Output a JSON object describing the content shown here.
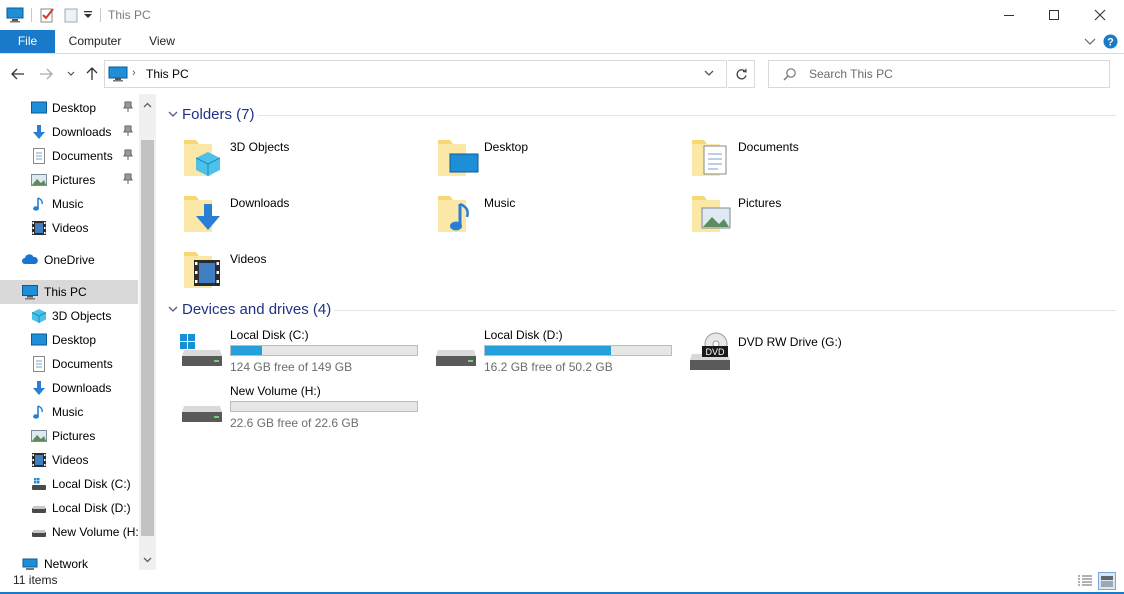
{
  "window": {
    "title": "This PC"
  },
  "ribbon": {
    "tabs": [
      "File",
      "Computer",
      "View"
    ]
  },
  "address": {
    "crumb": "This PC",
    "search_placeholder": "Search This PC"
  },
  "sidebar": {
    "quick_access": [
      {
        "label": "Desktop",
        "icon": "desktop-icon",
        "pinned": true
      },
      {
        "label": "Downloads",
        "icon": "downloads-icon",
        "pinned": true
      },
      {
        "label": "Documents",
        "icon": "documents-icon",
        "pinned": true
      },
      {
        "label": "Pictures",
        "icon": "pictures-icon",
        "pinned": true
      },
      {
        "label": "Music",
        "icon": "music-icon",
        "pinned": false
      },
      {
        "label": "Videos",
        "icon": "videos-icon",
        "pinned": false
      }
    ],
    "onedrive": "OneDrive",
    "this_pc": "This PC",
    "this_pc_children": [
      {
        "label": "3D Objects",
        "icon": "3d-objects-icon"
      },
      {
        "label": "Desktop",
        "icon": "desktop-icon"
      },
      {
        "label": "Documents",
        "icon": "documents-icon"
      },
      {
        "label": "Downloads",
        "icon": "downloads-icon"
      },
      {
        "label": "Music",
        "icon": "music-icon"
      },
      {
        "label": "Pictures",
        "icon": "pictures-icon"
      },
      {
        "label": "Videos",
        "icon": "videos-icon"
      },
      {
        "label": "Local Disk (C:)",
        "icon": "drive-icon"
      },
      {
        "label": "Local Disk (D:)",
        "icon": "drive-icon"
      },
      {
        "label": "New Volume (H:",
        "icon": "drive-icon"
      }
    ],
    "network": "Network"
  },
  "folders": {
    "header": "Folders (7)",
    "items": [
      {
        "label": "3D Objects",
        "icon": "3d-objects-folder-icon"
      },
      {
        "label": "Desktop",
        "icon": "desktop-folder-icon"
      },
      {
        "label": "Documents",
        "icon": "documents-folder-icon"
      },
      {
        "label": "Downloads",
        "icon": "downloads-folder-icon"
      },
      {
        "label": "Music",
        "icon": "music-folder-icon"
      },
      {
        "label": "Pictures",
        "icon": "pictures-folder-icon"
      },
      {
        "label": "Videos",
        "icon": "videos-folder-icon"
      }
    ]
  },
  "drives": {
    "header": "Devices and drives (4)",
    "items": [
      {
        "label": "Local Disk (C:)",
        "free": "124 GB free of 149 GB",
        "used_fraction": 0.168
      },
      {
        "label": "Local Disk (D:)",
        "free": "16.2 GB free of 50.2 GB",
        "used_fraction": 0.677
      },
      {
        "label": "DVD RW Drive (G:)",
        "badge": "DVD"
      },
      {
        "label": "New Volume (H:)",
        "free": "22.6 GB free of 22.6 GB",
        "used_fraction": 0.0
      }
    ]
  },
  "status": {
    "count": "11 items"
  },
  "colors": {
    "accent": "#1979ca",
    "bar_fill": "#26a0da",
    "group_header": "#1e3287",
    "folder": "#f8d775",
    "selected": "#d9d9d9"
  }
}
